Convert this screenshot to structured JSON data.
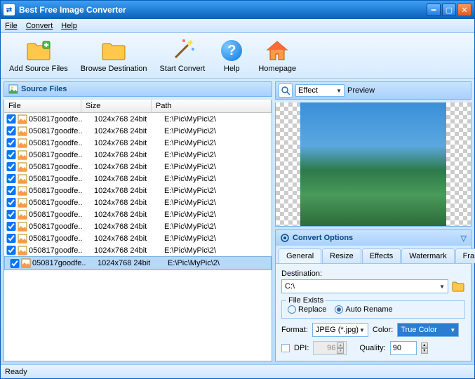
{
  "title": "Best Free Image Converter",
  "menu": {
    "file": "File",
    "convert": "Convert",
    "help": "Help"
  },
  "toolbar": {
    "add_source": "Add Source Files",
    "browse_dest": "Browse Destination",
    "start_convert": "Start Convert",
    "help": "Help",
    "homepage": "Homepage"
  },
  "source_files": {
    "title": "Source Files",
    "cols": {
      "file": "File",
      "size": "Size",
      "path": "Path"
    },
    "rows": [
      {
        "file": "050817goodfe..",
        "size": "1024x768  24bit",
        "path": "E:\\Pic\\MyPic\\2\\",
        "sel": false
      },
      {
        "file": "050817goodfe..",
        "size": "1024x768  24bit",
        "path": "E:\\Pic\\MyPic\\2\\",
        "sel": false
      },
      {
        "file": "050817goodfe..",
        "size": "1024x768  24bit",
        "path": "E:\\Pic\\MyPic\\2\\",
        "sel": false
      },
      {
        "file": "050817goodfe..",
        "size": "1024x768  24bit",
        "path": "E:\\Pic\\MyPic\\2\\",
        "sel": false
      },
      {
        "file": "050817goodfe..",
        "size": "1024x768  24bit",
        "path": "E:\\Pic\\MyPic\\2\\",
        "sel": false
      },
      {
        "file": "050817goodfe..",
        "size": "1024x768  24bit",
        "path": "E:\\Pic\\MyPic\\2\\",
        "sel": false
      },
      {
        "file": "050817goodfe..",
        "size": "1024x768  24bit",
        "path": "E:\\Pic\\MyPic\\2\\",
        "sel": false
      },
      {
        "file": "050817goodfe..",
        "size": "1024x768  24bit",
        "path": "E:\\Pic\\MyPic\\2\\",
        "sel": false
      },
      {
        "file": "050817goodfe..",
        "size": "1024x768  24bit",
        "path": "E:\\Pic\\MyPic\\2\\",
        "sel": false
      },
      {
        "file": "050817goodfe..",
        "size": "1024x768  24bit",
        "path": "E:\\Pic\\MyPic\\2\\",
        "sel": false
      },
      {
        "file": "050817goodfe..",
        "size": "1024x768  24bit",
        "path": "E:\\Pic\\MyPic\\2\\",
        "sel": false
      },
      {
        "file": "050817goodfe..",
        "size": "1024x768  24bit",
        "path": "E:\\Pic\\MyPic\\2\\",
        "sel": false
      },
      {
        "file": "050817goodfe..",
        "size": "1024x768  24bit",
        "path": "E:\\Pic\\MyPic\\2\\",
        "sel": true
      }
    ]
  },
  "preview": {
    "effect_label": "Effect",
    "preview_label": "Preview"
  },
  "convert": {
    "title": "Convert Options",
    "tabs": {
      "general": "General",
      "resize": "Resize",
      "effects": "Effects",
      "watermark": "Watermark",
      "frame": "Frame"
    },
    "destination_label": "Destination:",
    "destination_value": "C:\\",
    "file_exists_label": "File Exists",
    "replace_label": "Replace",
    "auto_rename_label": "Auto Rename",
    "format_label": "Format:",
    "format_value": "JPEG (*.jpg)",
    "color_label": "Color:",
    "color_value": "True Color",
    "dpi_label": "DPI:",
    "dpi_value": "96",
    "quality_label": "Quality:",
    "quality_value": "90"
  },
  "status": "Ready"
}
